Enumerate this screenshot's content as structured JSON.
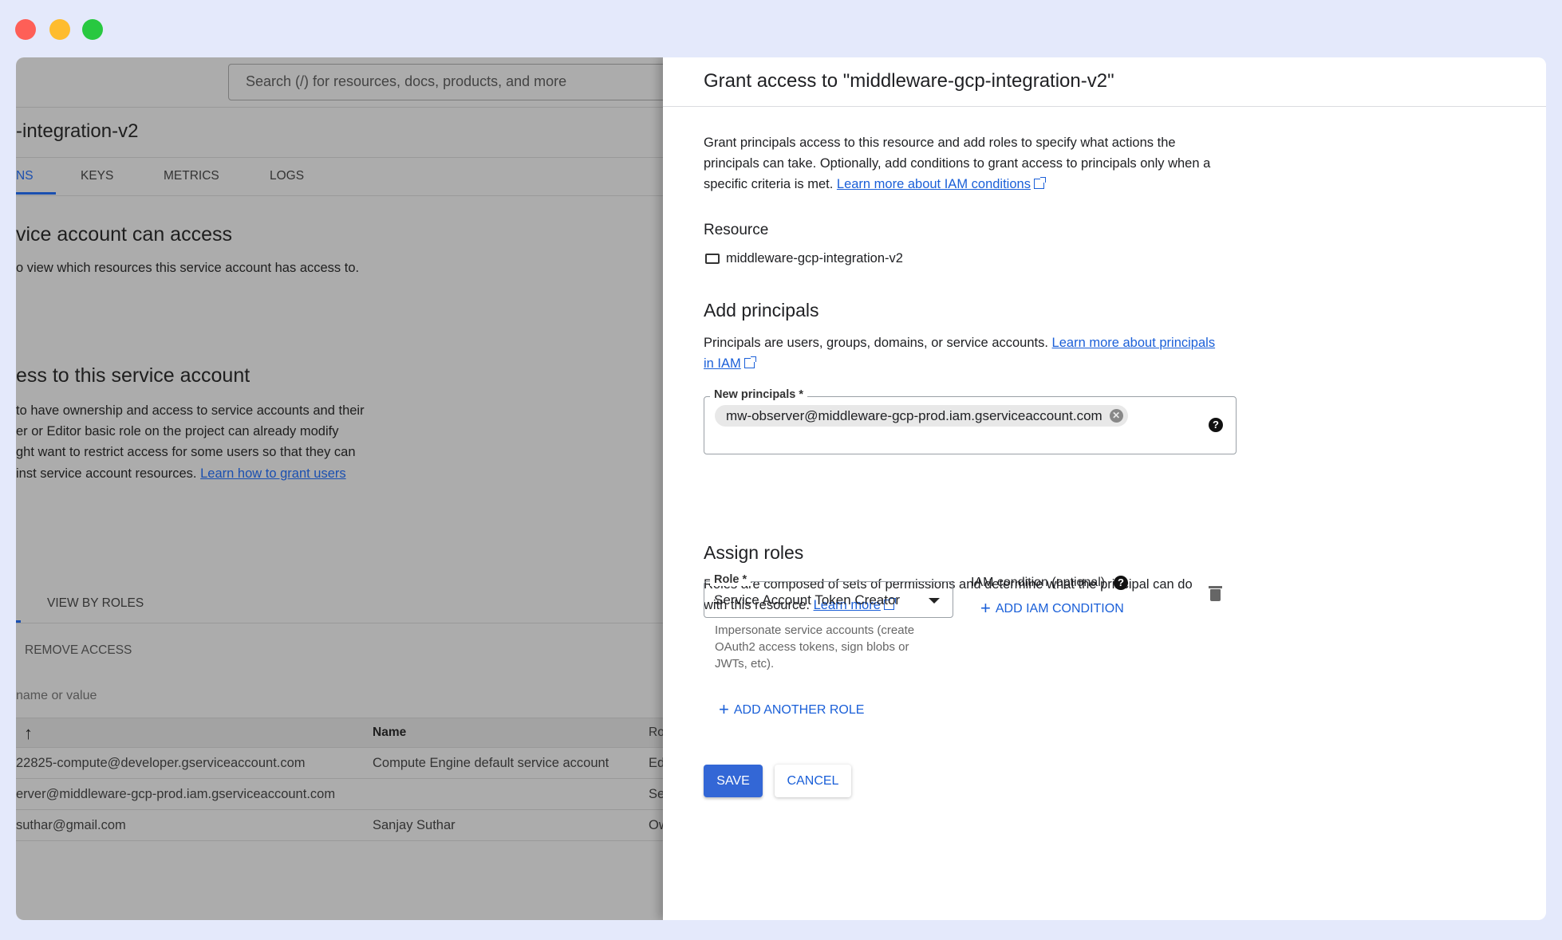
{
  "window_controls": {
    "close_color": "#fe5f57",
    "minimize_color": "#febc2e",
    "maximize_color": "#28c840"
  },
  "background": {
    "search_placeholder": "Search (/) for resources, docs, products, and more",
    "title": "-integration-v2",
    "tabs": [
      "NS",
      "KEYS",
      "METRICS",
      "LOGS"
    ],
    "section1_title": "vice account can access",
    "section1_text": "o view which resources this service account has access to.",
    "section2_title": "ess to this service account",
    "section2_lines": [
      "to have ownership and access to service accounts and their",
      "er or Editor basic role on the project can already modify",
      "ght want to restrict access for some users so that they can",
      "inst service account resources."
    ],
    "section2_link": "Learn how to grant users",
    "view_by_roles": "VIEW BY ROLES",
    "remove_access": "REMOVE ACCESS",
    "filter_placeholder": "name or value",
    "table": {
      "headers": [
        "Name",
        "Ro"
      ],
      "rows": [
        [
          "22825-compute@developer.gserviceaccount.com",
          "Compute Engine default service account",
          "Ed"
        ],
        [
          "erver@middleware-gcp-prod.iam.gserviceaccount.com",
          "",
          "Se"
        ],
        [
          "suthar@gmail.com",
          "Sanjay Suthar",
          "Ow"
        ]
      ]
    }
  },
  "panel": {
    "title": "Grant access to \"middleware-gcp-integration-v2\"",
    "intro_lines": [
      "Grant principals access to this resource and add roles to specify what actions the",
      "principals can take. Optionally, add conditions to grant access to principals only when a",
      "specific criteria is met."
    ],
    "intro_link": "Learn more about IAM conditions",
    "resource_heading": "Resource",
    "resource_name": "middleware-gcp-integration-v2",
    "add_principals_heading": "Add principals",
    "principals_text": "Principals are users, groups, domains, or service accounts.",
    "principals_link_1": "Learn more about principals",
    "principals_link_2": "in IAM",
    "new_principals_label": "New principals *",
    "principal_chip": "mw-observer@middleware-gcp-prod.iam.gserviceaccount.com",
    "assign_roles_heading": "Assign roles",
    "roles_text_1": "Roles are composed of sets of permissions and determine what the principal can do",
    "roles_text_2": "with this resource.",
    "roles_link": "Learn more",
    "role_label": "Role *",
    "role_value": "Service Account Token Creator",
    "role_help_lines": [
      "Impersonate service accounts (create",
      "OAuth2 access tokens, sign blobs or",
      "JWTs, etc)."
    ],
    "iam_condition_label": "IAM condition (optional)",
    "add_iam_condition": "ADD IAM CONDITION",
    "add_another_role": "ADD ANOTHER ROLE",
    "save": "SAVE",
    "cancel": "CANCEL",
    "accent": "#1a5fd8",
    "save_color": "#3367d6"
  }
}
